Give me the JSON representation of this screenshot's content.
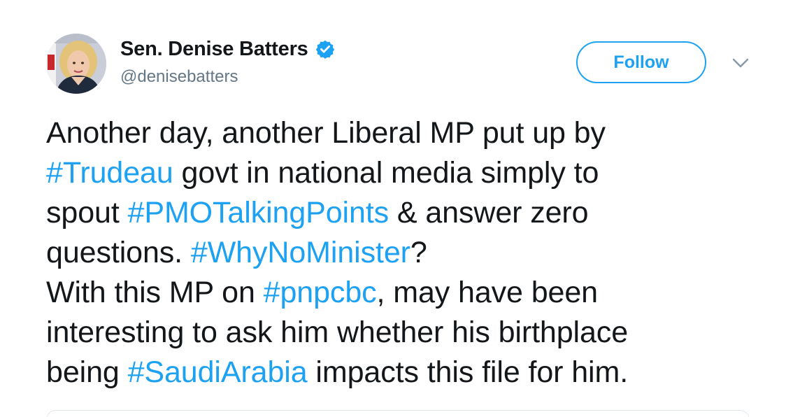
{
  "author": {
    "display_name": "Sen. Denise Batters",
    "handle": "@denisebatters",
    "verified": true,
    "avatar_icon": "profile-photo"
  },
  "actions": {
    "follow_label": "Follow",
    "menu_icon": "chevron-down-icon"
  },
  "tweet": {
    "lines": [
      [
        {
          "text": "Another day, another Liberal MP put up by",
          "hashtag": false
        }
      ],
      [
        {
          "text": "#Trudeau",
          "hashtag": true
        },
        {
          "text": " govt in national media simply to",
          "hashtag": false
        }
      ],
      [
        {
          "text": "spout ",
          "hashtag": false
        },
        {
          "text": "#PMOTalkingPoints",
          "hashtag": true
        },
        {
          "text": " & answer zero",
          "hashtag": false
        }
      ],
      [
        {
          "text": "questions. ",
          "hashtag": false
        },
        {
          "text": "#WhyNoMinister",
          "hashtag": true
        },
        {
          "text": "?",
          "hashtag": false
        }
      ],
      [
        {
          "text": "With this MP on ",
          "hashtag": false
        },
        {
          "text": "#pnpcbc",
          "hashtag": true
        },
        {
          "text": ", may have been",
          "hashtag": false
        }
      ],
      [
        {
          "text": "interesting to ask him whether his birthplace",
          "hashtag": false
        }
      ],
      [
        {
          "text": "being ",
          "hashtag": false
        },
        {
          "text": "#SaudiArabia",
          "hashtag": true
        },
        {
          "text": " impacts this file for him.",
          "hashtag": false
        }
      ]
    ]
  },
  "colors": {
    "link": "#1da1f2",
    "text": "#14171a",
    "secondary": "#657786",
    "border": "#e1e8ed"
  }
}
